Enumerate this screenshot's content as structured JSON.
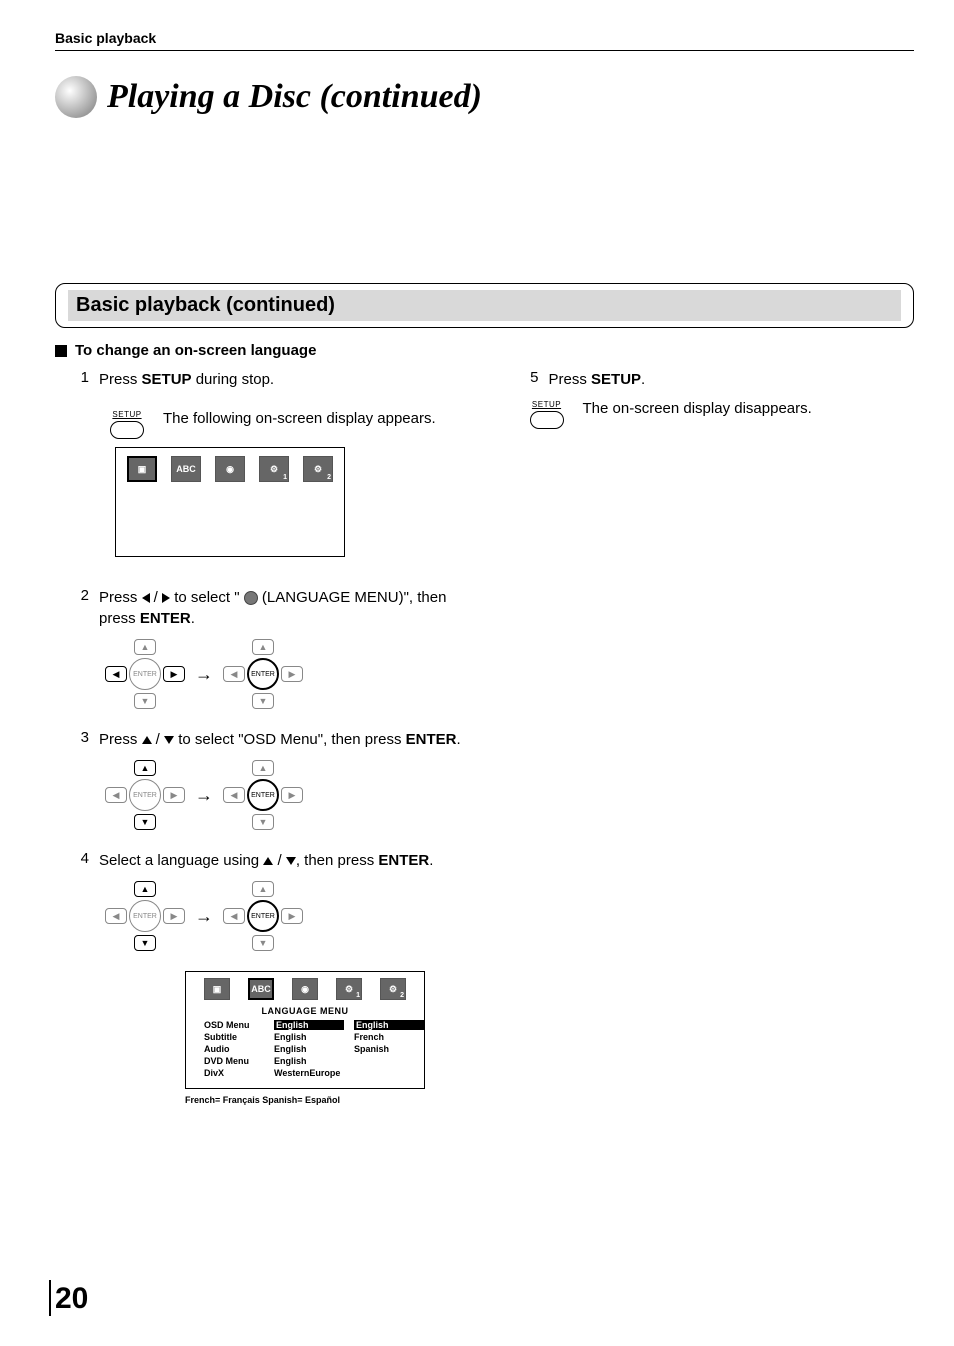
{
  "header": {
    "crumb": "Basic playback"
  },
  "title": "Playing a Disc (continued)",
  "section": {
    "heading": "Basic playback (continued)",
    "sub": "To change an on-screen language"
  },
  "steps": {
    "s1": {
      "num": "1",
      "text_pre": "Press ",
      "btn": "SETUP",
      "text_post": " during stop."
    },
    "s1_setup_label": "SETUP",
    "s1_setup_text": "The following on-screen display appears.",
    "s2": {
      "num": "2",
      "text_pre": "Press ",
      "sep": " / ",
      "mid": " to select \" ",
      "mid2": " (LANGUAGE MENU)\", then press ",
      "btn": "ENTER",
      "post": "."
    },
    "s3": {
      "num": "3",
      "text_pre": "Press ",
      "sep": " / ",
      "mid": " to select \"OSD Menu\", then press ",
      "btn": "ENTER",
      "post": "."
    },
    "s4": {
      "num": "4",
      "text_pre": "Select a language using ",
      "sep": " / ",
      "mid": ", then press ",
      "btn": "ENTER",
      "post": "."
    },
    "s5": {
      "num": "5",
      "text_pre": "Press ",
      "btn": "SETUP",
      "post": "."
    },
    "s5_setup_label": "SETUP",
    "s5_setup_text": "The on-screen display disappears."
  },
  "dpad": {
    "enter": "ENTER"
  },
  "menu_icons": {
    "tv": "",
    "globe": "ABC",
    "disc": "",
    "gear1": "",
    "gear1_corner": "1",
    "gear2": "",
    "gear2_corner": "2"
  },
  "lang_menu": {
    "title": "LANGUAGE MENU",
    "rows": [
      {
        "label": "OSD Menu",
        "val": "English",
        "opt": "English",
        "val_hl": true,
        "opt_hl": true
      },
      {
        "label": "Subtitle",
        "val": "English",
        "opt": "French"
      },
      {
        "label": "Audio",
        "val": "English",
        "opt": "Spanish"
      },
      {
        "label": "DVD Menu",
        "val": "English",
        "opt": ""
      },
      {
        "label": "DivX",
        "val": "WesternEurope",
        "opt": ""
      }
    ],
    "footnote": "French= Français   Spanish= Español"
  },
  "page_number": "20"
}
